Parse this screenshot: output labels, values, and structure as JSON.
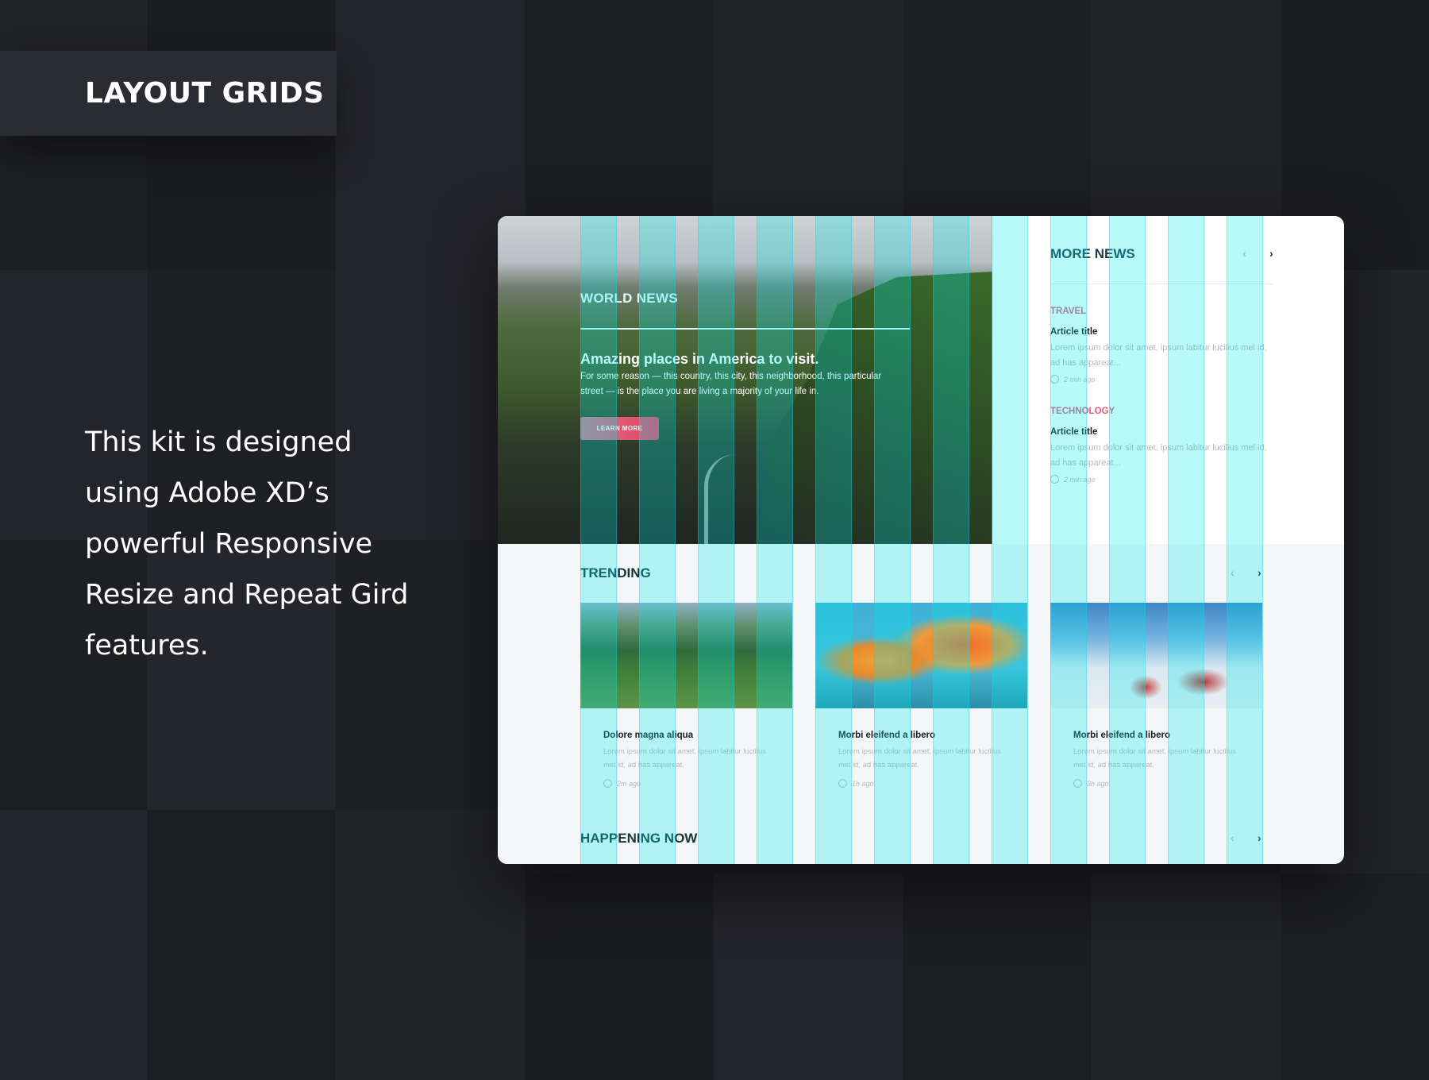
{
  "badge": {
    "title": "LAYOUT GRIDS"
  },
  "intro": {
    "lines": [
      "This kit is designed",
      "using Adobe XD’s",
      "powerful Responsive",
      "Resize and Repeat Gird",
      "features."
    ]
  },
  "colors": {
    "background": "#1f2024",
    "grid_overlay": "#00e8ec",
    "accent": "#ef3f63",
    "category": "#d96079"
  },
  "hero": {
    "section_label": "WORLD NEWS",
    "headline": "Amazing places in America to visit.",
    "body": "For some reason — this country, this city, this neighborhood, this particular street — is the place you are living a majority of your life in.",
    "button_label": "LEARN MORE"
  },
  "more_news": {
    "title": "MORE NEWS",
    "prev_icon": "chevron-left-icon",
    "next_icon": "chevron-right-icon",
    "articles": [
      {
        "category": "TRAVEL",
        "title": "Article title",
        "body": "Lorem ipsum dolor sit amet, ipsum labitur lucilius mel id, ad has appareat...",
        "time": "2 min ago"
      },
      {
        "category": "TECHNOLOGY",
        "title": "Article title",
        "body": "Lorem ipsum dolor sit amet, ipsum labitur lucilius mel id, ad has appareat...",
        "time": "2 min ago"
      }
    ]
  },
  "trending": {
    "title": "TRENDING",
    "cards": [
      {
        "title": "Dolore magna aliqua",
        "body": "Lorem ipsum dolor sit amet, ipsum labitur lucilius mel id, ad has appareat.",
        "time": "2m ago"
      },
      {
        "title": "Morbi eleifend a libero",
        "body": "Lorem ipsum dolor sit amet, ipsum labitur lucilius mel id, ad has appareat.",
        "time": "1h ago"
      },
      {
        "title": "Morbi eleifend a libero",
        "body": "Lorem ipsum dolor sit amet, ipsum labitur lucilius mel id, ad has appareat.",
        "time": "3h ago"
      }
    ]
  },
  "happening_now": {
    "title": "HAPPENING NOW"
  }
}
